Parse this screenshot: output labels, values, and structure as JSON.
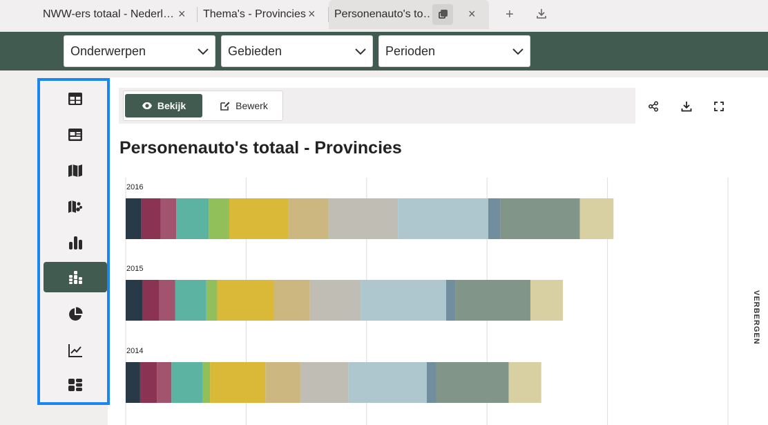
{
  "tabs": [
    {
      "label": "NWW-ers totaal - Nederl…",
      "active": false
    },
    {
      "label": "Thema's - Provincies",
      "active": false
    },
    {
      "label": "Personenauto's to…",
      "active": true
    }
  ],
  "tab_close_glyph": "×",
  "new_tab_glyph": "+",
  "filters": [
    {
      "label": "Onderwerpen"
    },
    {
      "label": "Gebieden"
    },
    {
      "label": "Perioden"
    }
  ],
  "rail_icons": [
    "table-icon",
    "dashboard-icon",
    "map-icon",
    "map-symbols-icon",
    "bar-chart-icon",
    "stacked-bar-chart-icon",
    "pie-chart-icon",
    "line-chart-icon",
    "tiles-icon"
  ],
  "rail_active_index": 5,
  "view": {
    "view_label": "Bekijk",
    "edit_label": "Bewerk"
  },
  "actions": [
    "share-icon",
    "download-icon",
    "fullscreen-icon"
  ],
  "page": {
    "title": "Personenauto's totaal - Provincies"
  },
  "hide_label": "VERBERGEN",
  "colors": {
    "brand_green": "#425b51",
    "highlight_border": "#1a86f0",
    "palette": [
      "#283a48",
      "#8a3353",
      "#a2546e",
      "#5cb3a1",
      "#91c05a",
      "#dab938",
      "#cbb77f",
      "#c0beb4",
      "#aec7cf",
      "#718e9e",
      "#819689",
      "#d8cfa2"
    ]
  },
  "chart_data": {
    "type": "bar",
    "orientation": "horizontal",
    "stacked": true,
    "categories": [
      "2016",
      "2015",
      "2014"
    ],
    "series": [
      {
        "values": [
          13,
          14,
          12
        ]
      },
      {
        "values": [
          16,
          14,
          14
        ]
      },
      {
        "values": [
          13,
          13,
          12
        ]
      },
      {
        "values": [
          27,
          26,
          26
        ]
      },
      {
        "values": [
          17,
          9,
          6
        ]
      },
      {
        "values": [
          49,
          47,
          46
        ]
      },
      {
        "values": [
          33,
          30,
          29
        ]
      },
      {
        "values": [
          58,
          42,
          40
        ]
      },
      {
        "values": [
          75,
          71,
          65
        ]
      },
      {
        "values": [
          10,
          8,
          8
        ]
      },
      {
        "values": [
          66,
          62,
          60
        ]
      },
      {
        "values": [
          28,
          27,
          27
        ]
      }
    ],
    "xlim": [
      0,
      500
    ],
    "grid": true,
    "legend": "none"
  }
}
